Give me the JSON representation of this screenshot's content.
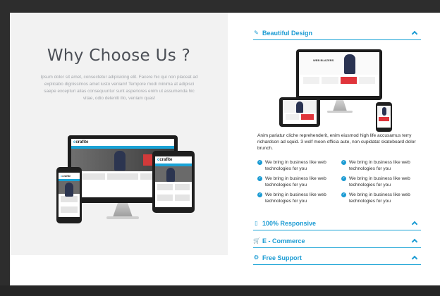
{
  "left": {
    "title": "Why Choose Us ?",
    "intro": "Ipsum dolor sit amet, consectetur adipisicing elit. Facere hic qui non placeat ad explicabo dignissimos amet iusto veniam! Tempore modi minima at adipisci saepe excepturi alias consequuntur sunt asperiores enim ut assumenda hic vitae, odio deleniti illo, veniam quas!",
    "brand_logo": "crafite",
    "brand_initial": "c"
  },
  "right": {
    "preview_headline": "WEB BLAZERS",
    "preview_sale": "SALE",
    "description": "Anim pariatur cliche reprehenderit, enim eiusmod high life accusamus terry richardson ad squid. 3 wolf moon officia aute, non cupidatat skateboard dolor brunch.",
    "features": [
      "We bring in business like web technologies for you",
      "We bring in business like web technologies for you",
      "We bring in business like web technologies for you",
      "We bring in business like web technologies for you",
      "We bring in business like web technologies for you",
      "We bring in business like web technologies for you"
    ],
    "accordion": [
      {
        "label": "Beautiful Design",
        "icon": "brush-icon",
        "expanded": true
      },
      {
        "label": "100% Responsive",
        "icon": "mobile-icon",
        "expanded": false
      },
      {
        "label": "E - Commerce",
        "icon": "cart-icon",
        "expanded": false
      },
      {
        "label": "Free Support",
        "icon": "lifebuoy-icon",
        "expanded": false
      }
    ]
  },
  "colors": {
    "accent": "#1b9bd3",
    "dark_frame": "#2d2d2d",
    "panel_bg": "#f2f2f2"
  }
}
